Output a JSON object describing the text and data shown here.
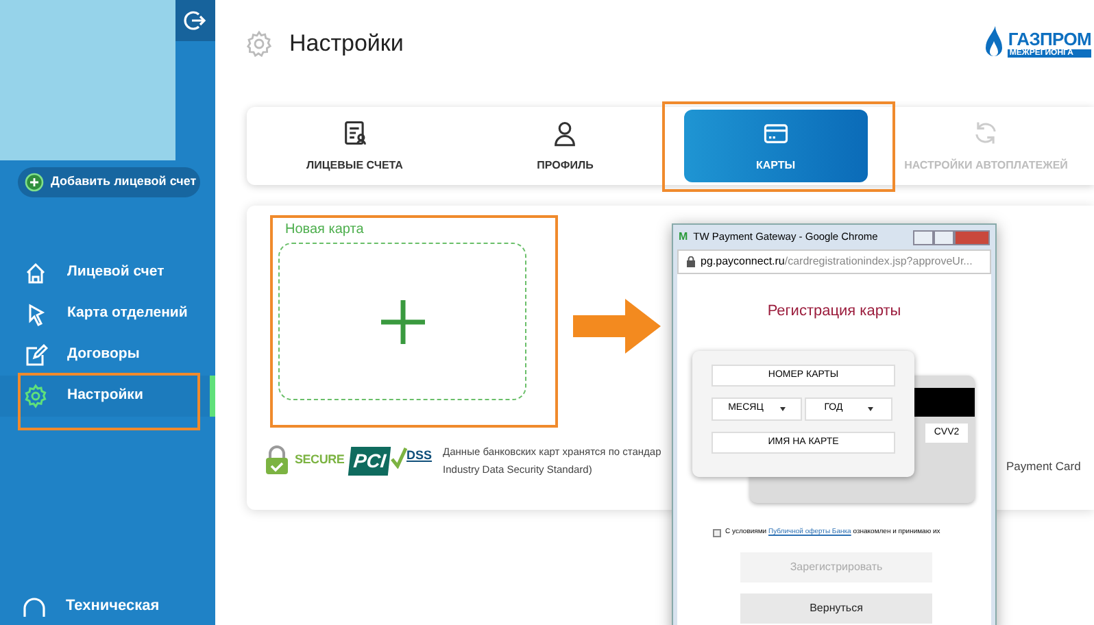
{
  "sidebar": {
    "add_account_button": "Добавить лицевой счет",
    "items": [
      {
        "label": "Лицевой счет",
        "selected": false,
        "highlighted": false
      },
      {
        "label": "Карта отделений",
        "selected": false,
        "highlighted": false
      },
      {
        "label": "Договоры",
        "selected": false,
        "highlighted": false
      },
      {
        "label": "Настройки",
        "selected": true,
        "highlighted": true
      }
    ],
    "support_item": "Техническая"
  },
  "header": {
    "title": "Настройки",
    "logo_line1": "ГАЗПРОМ",
    "logo_line2": "МЕЖРЕГИОНГА"
  },
  "tabs": [
    {
      "label": "ЛИЦЕВЫЕ СЧЕТА",
      "selected": false,
      "disabled": false,
      "highlighted": false
    },
    {
      "label": "ПРОФИЛЬ",
      "selected": false,
      "disabled": false,
      "highlighted": false
    },
    {
      "label": "КАРТЫ",
      "selected": true,
      "disabled": false,
      "highlighted": true
    },
    {
      "label": "НАСТРОЙКИ АВТОПЛАТЕЖЕЙ",
      "selected": false,
      "disabled": true,
      "highlighted": false
    }
  ],
  "new_card": {
    "label": "Новая карта",
    "highlighted": true
  },
  "security": {
    "secure_badge": "SECURE",
    "pci": "PCI",
    "dss": "DSS",
    "text_line1": "Данные банковских карт хранятся по стандар",
    "text_right": "Payment Card",
    "text_line2": "Industry Data Security Standard)"
  },
  "popup": {
    "app_icon": "M",
    "title": "TW Payment Gateway - Google Chrome",
    "url_host": "pg.payconnect.ru",
    "url_path": "/cardregistrationindex.jsp?approveUr...",
    "heading": "Регистрация карты",
    "card_number": "НОМЕР КАРТЫ",
    "month": "МЕСЯЦ",
    "year": "ГОД",
    "name_on_card": "ИМЯ НА КАРТЕ",
    "cvv": "CVV2",
    "terms": {
      "checked": false,
      "before": "С условиями",
      "link": "Публичной оферты Банка",
      "after": "ознакомлен и принимаю их"
    },
    "buttons": [
      {
        "label": "Зарегистрировать",
        "disabled": true
      },
      {
        "label": "Вернуться",
        "disabled": false
      }
    ]
  }
}
